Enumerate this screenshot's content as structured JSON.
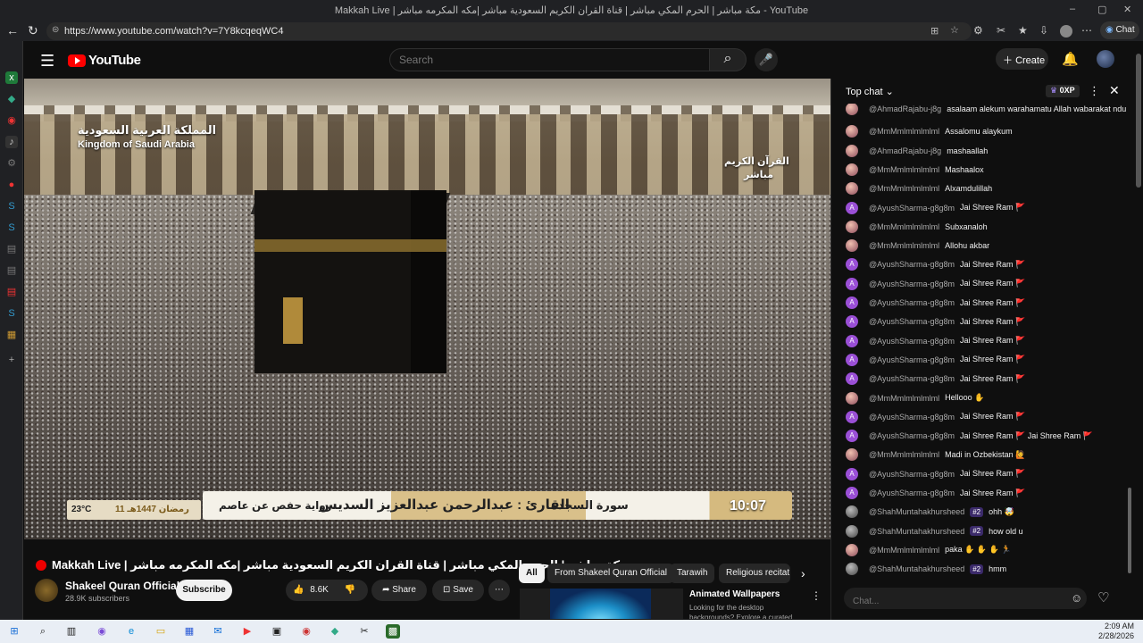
{
  "window": {
    "title": "Makkah Live | مكة مباشر | الحرم المكي مباشر | قناة القران الكريم السعودية مباشر |مكه المكرمه مباشر - YouTube",
    "minimize": "–",
    "maximize": "▢",
    "close": "✕"
  },
  "browser": {
    "url": "https://www.youtube.com/watch?v=7Y8kcqeqWC4",
    "chat_label": "Chat"
  },
  "youtube": {
    "logo_text": "YouTube",
    "search_placeholder": "Search",
    "create_label": "Create"
  },
  "video": {
    "overlay_country_ar": "المملكة العربية السعودية",
    "overlay_country_en": "Kingdom of Saudi Arabia",
    "overlay_channel_ar": "القرآن الكريم",
    "overlay_live_ar": "مباشر",
    "temperature": "23°C",
    "hijri_date": "11 رمضان 1447هـ",
    "riwaya": "رواية حفص عن عاصم",
    "reciter": "القارئ : عبدالرحمن عبدالعزيز السديس",
    "surah": "سورة السجدة",
    "time": "10:07"
  },
  "details": {
    "title": "Makkah Live | مكة مباشر | الحرم المكي مباشر | قناة القران الكريم السعودية مباشر |مكه المكرمه مباشر",
    "channel": "Shakeel Quran Official",
    "subscribers": "28.9K subscribers",
    "subscribe": "Subscribe",
    "likes": "8.6K",
    "share": "Share",
    "save": "Save"
  },
  "chips": [
    {
      "label": "All"
    },
    {
      "label": "From Shakeel Quran Official"
    },
    {
      "label": "Tarawih"
    },
    {
      "label": "Religious recitat"
    }
  ],
  "recommendation": {
    "title": "Animated Wallpapers",
    "description": "Looking for the desktop backgrounds? Explore a curated"
  },
  "chat": {
    "header": "Top chat",
    "xp": "0XP",
    "input_placeholder": "Chat...",
    "messages": [
      {
        "author": "@AhmadRajabu-j8g",
        "text": "asalaam alekum warahamatu Allah wabarakat ndugu zangu",
        "avatar": "m"
      },
      {
        "author": "@MmMmlmlmlmlml",
        "text": "Assalomu alaykum",
        "avatar": "m"
      },
      {
        "author": "@AhmadRajabu-j8g",
        "text": "mashaallah",
        "avatar": "m"
      },
      {
        "author": "@MmMmlmlmlmlml",
        "text": "Mashaalox",
        "avatar": "m"
      },
      {
        "author": "@MmMmlmlmlmlml",
        "text": "Alxamdulillah",
        "avatar": "m"
      },
      {
        "author": "@AyushSharma-g8g8m",
        "text": "Jai Shree Ram 🚩",
        "avatar": "a"
      },
      {
        "author": "@MmMmlmlmlmlml",
        "text": "Subxanaloh",
        "avatar": "m"
      },
      {
        "author": "@MmMmlmlmlmlml",
        "text": "Allohu akbar",
        "avatar": "m"
      },
      {
        "author": "@AyushSharma-g8g8m",
        "text": "Jai Shree Ram 🚩",
        "avatar": "a"
      },
      {
        "author": "@AyushSharma-g8g8m",
        "text": "Jai Shree Ram 🚩",
        "avatar": "a"
      },
      {
        "author": "@AyushSharma-g8g8m",
        "text": "Jai Shree Ram 🚩",
        "avatar": "a"
      },
      {
        "author": "@AyushSharma-g8g8m",
        "text": "Jai Shree Ram 🚩",
        "avatar": "a"
      },
      {
        "author": "@AyushSharma-g8g8m",
        "text": "Jai Shree Ram 🚩",
        "avatar": "a"
      },
      {
        "author": "@AyushSharma-g8g8m",
        "text": "Jai Shree Ram 🚩",
        "avatar": "a"
      },
      {
        "author": "@AyushSharma-g8g8m",
        "text": "Jai Shree Ram 🚩",
        "avatar": "a"
      },
      {
        "author": "@MmMmlmlmlmlml",
        "text": "Hellooo ✋",
        "avatar": "m"
      },
      {
        "author": "@AyushSharma-g8g8m",
        "text": "Jai Shree Ram 🚩",
        "avatar": "a"
      },
      {
        "author": "@AyushSharma-g8g8m",
        "text": "Jai Shree Ram 🚩 Jai Shree Ram 🚩",
        "avatar": "a"
      },
      {
        "author": "@MmMmlmlmlmlml",
        "text": "Madi in Ozbekistan 🙋",
        "avatar": "m"
      },
      {
        "author": "@AyushSharma-g8g8m",
        "text": "Jai Shree Ram 🚩",
        "avatar": "a"
      },
      {
        "author": "@AyushSharma-g8g8m",
        "text": "Jai Shree Ram 🚩",
        "avatar": "a"
      },
      {
        "author": "@ShahMuntahakhursheed",
        "badge": "#2",
        "text": "ohh 🤯",
        "avatar": "s"
      },
      {
        "author": "@ShahMuntahakhursheed",
        "badge": "#2",
        "text": "how old u",
        "avatar": "s"
      },
      {
        "author": "@MmMmlmlmlmlml",
        "text": "paka ✋ ✋ ✋ 🏃",
        "avatar": "m"
      },
      {
        "author": "@ShahMuntahakhursheed",
        "badge": "#2",
        "text": "hmm",
        "avatar": "s"
      }
    ]
  },
  "taskbar": {
    "time": "2:09 AM",
    "date": "2/28/2026"
  },
  "icons": {
    "back": "arrow-left-icon",
    "refresh": "refresh-icon",
    "menu": "hamburger-menu-icon",
    "search": "search-icon",
    "mic": "microphone-icon",
    "bell": "bell-icon",
    "like": "thumbs-up-icon",
    "dislike": "thumbs-down-icon",
    "share": "share-icon",
    "save": "bookmark-icon"
  }
}
